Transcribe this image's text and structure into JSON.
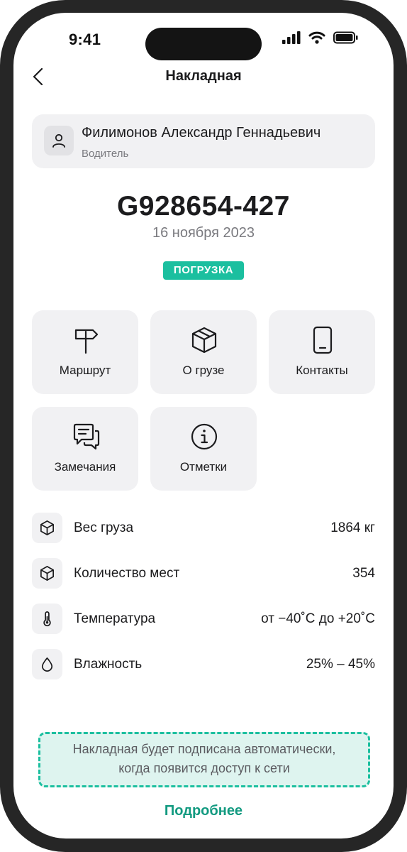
{
  "status_bar": {
    "time": "9:41"
  },
  "header": {
    "title": "Накладная"
  },
  "driver": {
    "name": "Филимонов Александр Геннадьевич",
    "role": "Водитель"
  },
  "document": {
    "number": "G928654-427",
    "date": "16 ноября 2023",
    "status": "ПОГРУЗКА"
  },
  "tiles": [
    {
      "label": "Маршрут",
      "icon": "signpost-icon"
    },
    {
      "label": "О грузе",
      "icon": "package-icon"
    },
    {
      "label": "Контакты",
      "icon": "phone-icon"
    },
    {
      "label": "Замечания",
      "icon": "chat-icon"
    },
    {
      "label": "Отметки",
      "icon": "info-icon"
    }
  ],
  "details": [
    {
      "label": "Вес груза",
      "value": "1864 кг",
      "icon": "package-icon"
    },
    {
      "label": "Количество мест",
      "value": "354",
      "icon": "package-icon"
    },
    {
      "label": "Температура",
      "value": "от −40˚C до +20˚C",
      "icon": "thermometer-icon"
    },
    {
      "label": "Влажность",
      "value": "25% – 45%",
      "icon": "drop-icon"
    }
  ],
  "notice": {
    "line1": "Накладная будет подписана автоматически,",
    "line2": "когда появится доступ к сети"
  },
  "more_link": "Подробнее",
  "colors": {
    "accent": "#1bbf9f",
    "accent_dark": "#129a80",
    "notice_bg": "#def4ef",
    "card_bg": "#f1f1f3"
  }
}
